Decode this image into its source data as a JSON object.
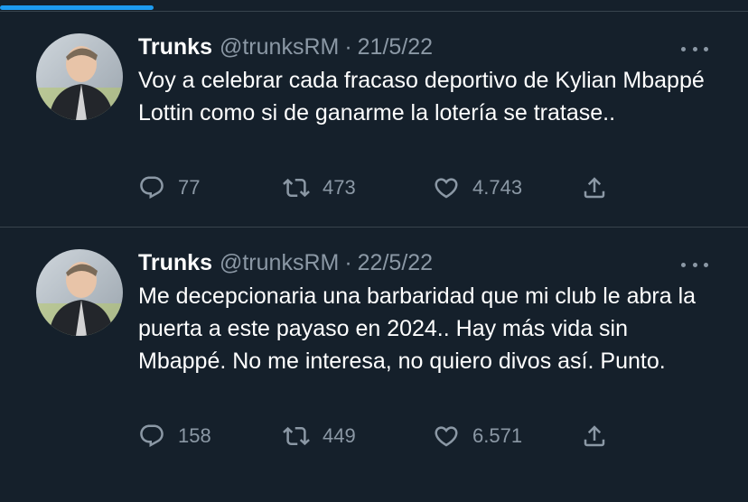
{
  "tweets": [
    {
      "name": "Trunks",
      "handle": "@trunksRM",
      "separator": "·",
      "date": "21/5/22",
      "text": "Voy a celebrar cada fracaso deportivo de Kylian Mbappé Lottin como si de ganarme la lotería se tratase..",
      "replies": "77",
      "retweets": "473",
      "likes": "4.743"
    },
    {
      "name": "Trunks",
      "handle": "@trunksRM",
      "separator": "·",
      "date": "22/5/22",
      "text": "Me decepcionaria una barbaridad que mi club le abra la puerta a este payaso en 2024.. Hay más vida sin Mbappé. No me interesa, no quiero divos así. Punto.",
      "replies": "158",
      "retweets": "449",
      "likes": "6.571"
    }
  ],
  "colors": {
    "background": "#15202b",
    "text": "#ffffff",
    "muted": "#8b98a5",
    "divider": "#38444d",
    "accent": "#1d9bf0"
  },
  "icons": [
    "reply-icon",
    "retweet-icon",
    "like-icon",
    "share-icon",
    "more-icon"
  ]
}
